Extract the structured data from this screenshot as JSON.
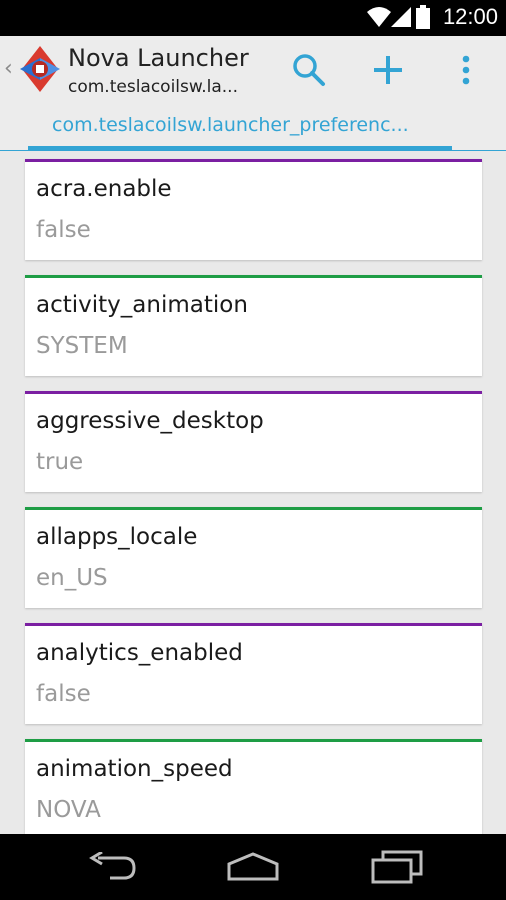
{
  "status_bar": {
    "time": "12:00"
  },
  "action_bar": {
    "title": "Nova Launcher",
    "subtitle": "com.teslacoilsw.la...",
    "icons": [
      "up-caret-icon",
      "nova-launcher-icon",
      "search-icon",
      "add-icon",
      "overflow-menu-icon"
    ]
  },
  "tabs": [
    {
      "label": "com.teslacoilsw.launcher_preferenc..."
    }
  ],
  "preferences": [
    {
      "key": "acra.enable",
      "value": "false",
      "accent": "#7b1fa2"
    },
    {
      "key": "activity_animation",
      "value": "SYSTEM",
      "accent": "#1e9d45"
    },
    {
      "key": "aggressive_desktop",
      "value": "true",
      "accent": "#7b1fa2"
    },
    {
      "key": "allapps_locale",
      "value": "en_US",
      "accent": "#1e9d45"
    },
    {
      "key": "analytics_enabled",
      "value": "false",
      "accent": "#7b1fa2"
    },
    {
      "key": "animation_speed",
      "value": "NOVA",
      "accent": "#1e9d45"
    }
  ],
  "colors": {
    "accent": "#33a4d4",
    "purple": "#7b1fa2",
    "green": "#1e9d45"
  },
  "nav_bar": {
    "icons": [
      "back-icon",
      "home-icon",
      "recents-icon"
    ]
  }
}
